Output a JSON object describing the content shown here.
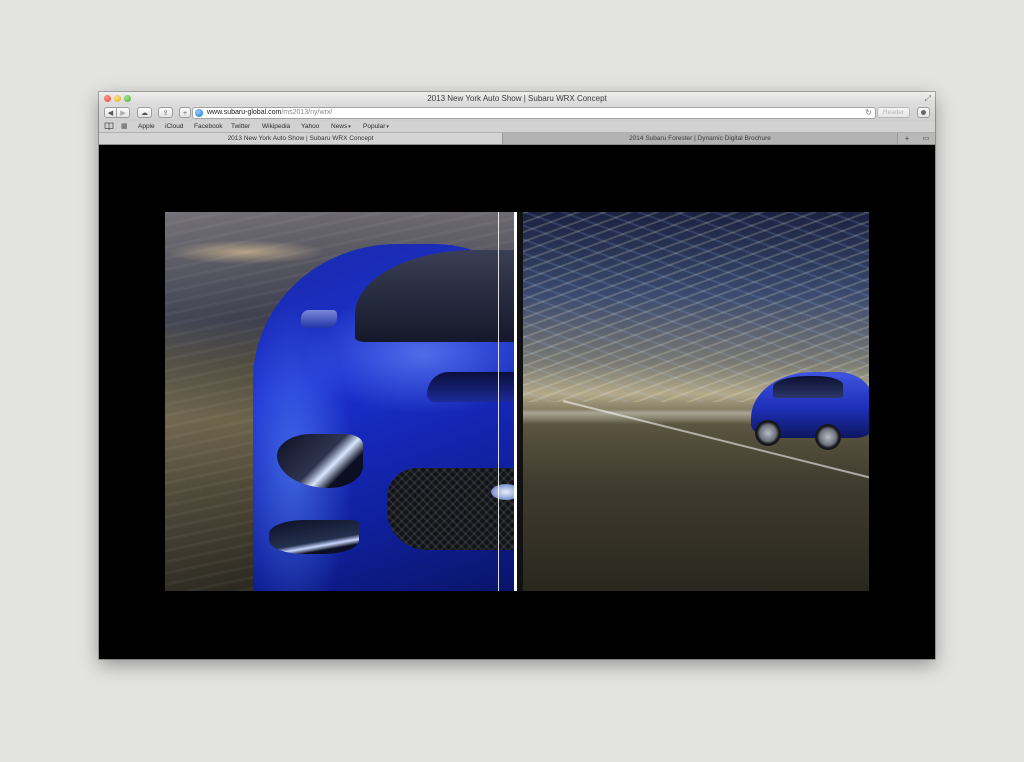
{
  "window": {
    "title": "2013 New York Auto Show | Subaru WRX Concept",
    "fullscreen_icon": "⤢"
  },
  "toolbar": {
    "back_icon": "◀",
    "forward_icon": "▶",
    "icloud_icon": "☁",
    "share_icon": "⇪",
    "newtab_icon": "+",
    "url_host": "www.subaru-global.com",
    "url_path": "/ms2013/ny/wrx/",
    "reload_icon": "↻",
    "reader_label": "Reader"
  },
  "bookmarks": {
    "items": [
      {
        "label": "Apple"
      },
      {
        "label": "iCloud"
      },
      {
        "label": "Facebook"
      },
      {
        "label": "Twitter"
      },
      {
        "label": "Wikipedia"
      },
      {
        "label": "Yahoo"
      },
      {
        "label": "News",
        "menu": true
      },
      {
        "label": "Popular",
        "menu": true
      }
    ],
    "book_icon": "📖",
    "grid_icon": "▦",
    "menu_caret": "▾"
  },
  "tabs": {
    "items": [
      {
        "label": "2013 New York Auto Show | Subaru WRX Concept",
        "active": true
      },
      {
        "label": "2014 Subaru Forester | Dynamic Digital Brochure",
        "active": false
      }
    ],
    "add_icon": "+",
    "overview_icon": "▭"
  },
  "content": {
    "hero_left": "subaru-wrx-concept-front",
    "hero_right": "subaru-wrx-concept-side"
  },
  "colors": {
    "page_background": "#000000",
    "desktop_background": "#e3e3e1",
    "car_blue": "#1b2fd0"
  }
}
